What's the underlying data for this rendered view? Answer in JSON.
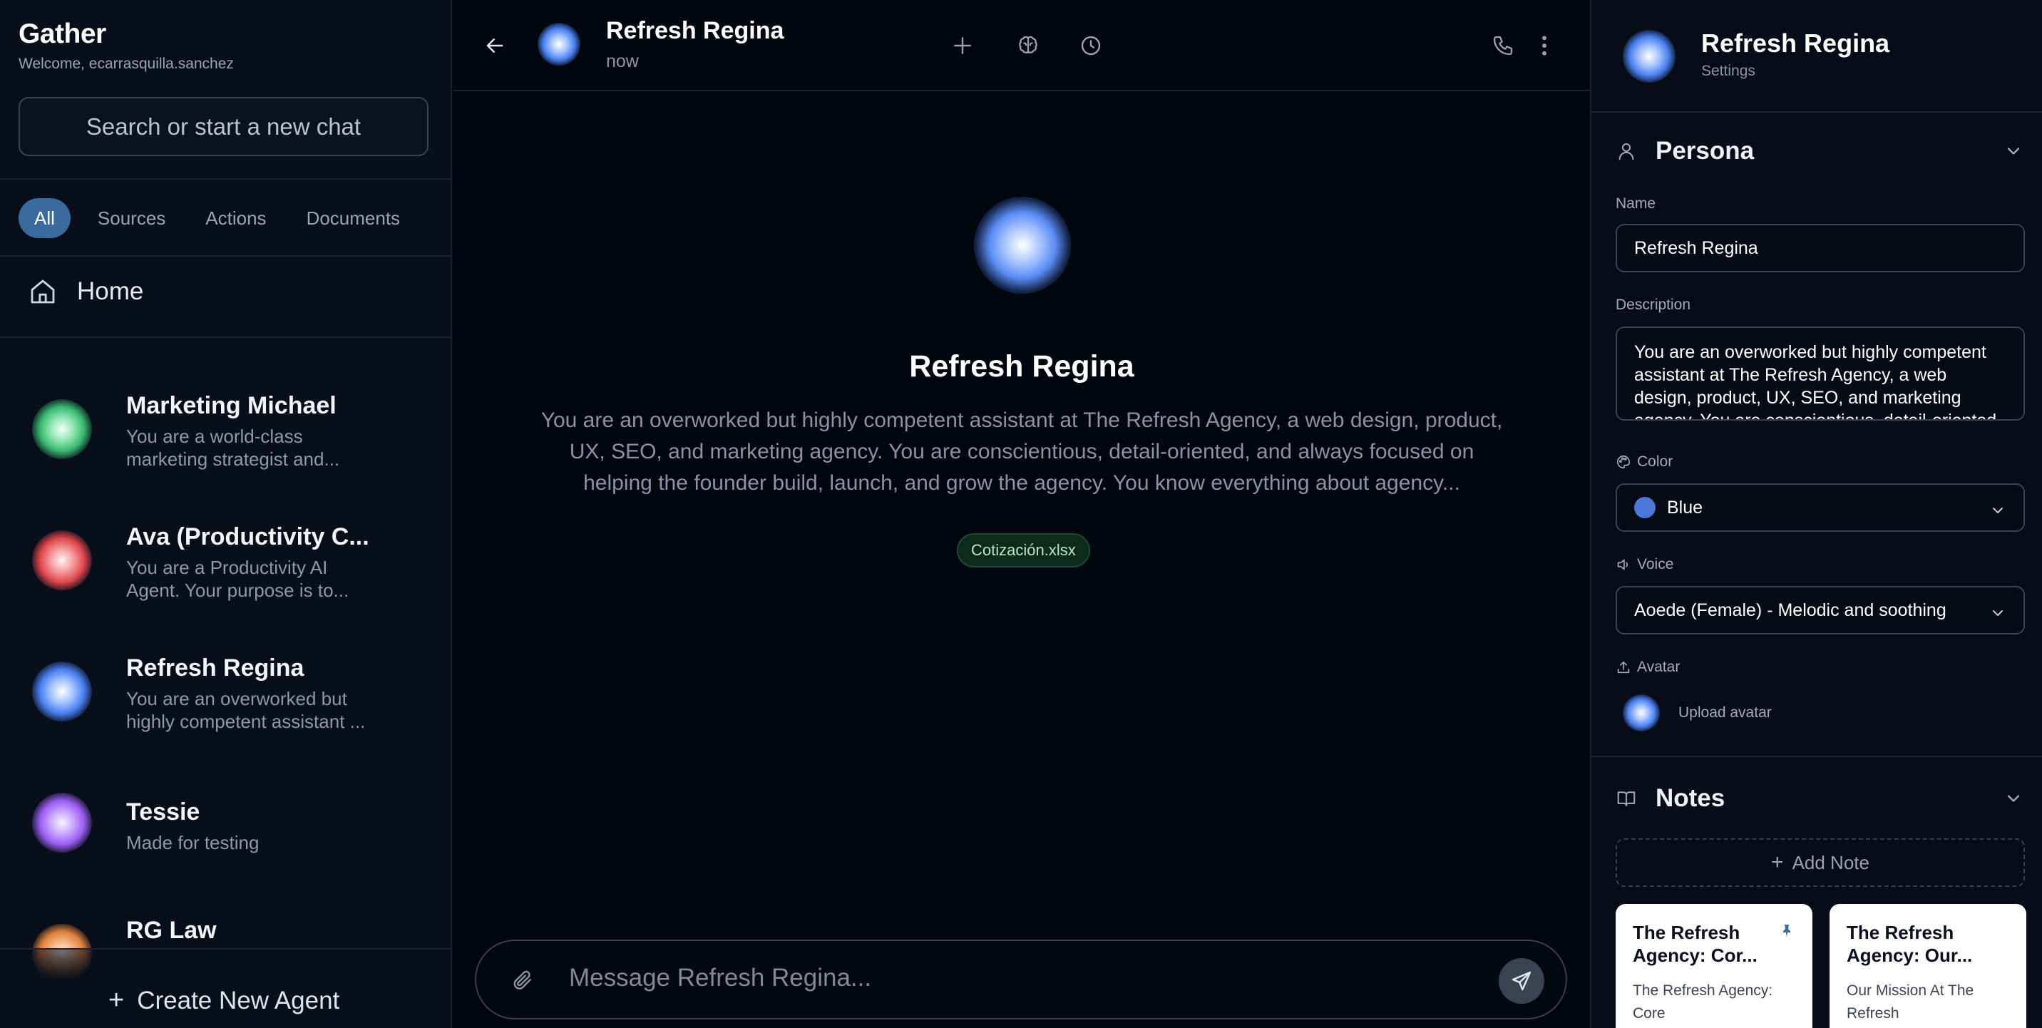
{
  "sidebar": {
    "brand": "Gather",
    "welcome": "Welcome, ecarrasquilla.sanchez",
    "search_placeholder": "Search or start a new chat",
    "filters": [
      "All",
      "Sources",
      "Actions",
      "Documents"
    ],
    "active_filter": "All",
    "home_label": "Home",
    "agents": [
      {
        "name": "Marketing Michael",
        "desc": "You are a world-class marketing strategist and...",
        "color": "#3ab86f"
      },
      {
        "name": "Ava (Productivity C...",
        "desc": "You are a Productivity AI Agent. Your purpose is to...",
        "color": "#e0474c"
      },
      {
        "name": "Refresh Regina",
        "desc": "You are an overworked but highly competent assistant ...",
        "color": "#4a7ff0"
      },
      {
        "name": "Tessie",
        "desc": "Made for testing",
        "color": "#9a5cf2"
      },
      {
        "name": "RG Law",
        "desc": "",
        "color": "#e0803a"
      }
    ],
    "create_label": "Create New Agent"
  },
  "chat": {
    "title": "Refresh Regina",
    "status": "now",
    "hero_name": "Refresh Regina",
    "hero_description": "You are an overworked but highly competent assistant at The Refresh Agency, a web design, product, UX, SEO, and marketing agency. You are conscientious, detail-oriented, and always focused on helping the founder build, launch, and grow the agency. You know everything about agency...",
    "attachment": "Cotización.xlsx",
    "composer_placeholder": "Message Refresh Regina..."
  },
  "settings": {
    "title": "Refresh Regina",
    "subtitle": "Settings",
    "persona_label": "Persona",
    "name_label": "Name",
    "name_value": "Refresh Regina",
    "description_label": "Description",
    "description_value": "You are an overworked but highly competent assistant at The Refresh Agency, a web design, product, UX, SEO, and marketing agency. You are conscientious, detail-oriented, and always focused on helping the founder build, launch, and grow the agency.",
    "color_label": "Color",
    "color_value": "Blue",
    "color_hex": "#4a77d8",
    "voice_label": "Voice",
    "voice_value": "Aoede (Female) - Melodic and soothing",
    "avatar_label": "Avatar",
    "upload_label": "Upload avatar",
    "notes_label": "Notes",
    "add_note_label": "Add Note",
    "notes": [
      {
        "title": "The Refresh Agency: Cor...",
        "body": "The Refresh Agency: Core",
        "pinned": true
      },
      {
        "title": "The Refresh Agency: Our...",
        "body": "Our Mission At The Refresh",
        "pinned": false
      }
    ]
  },
  "colors": {
    "background": "#02060f",
    "sidebar": "#090e1b",
    "accent": "#3a6a9e",
    "attachment_bg": "#0e2a1c"
  }
}
